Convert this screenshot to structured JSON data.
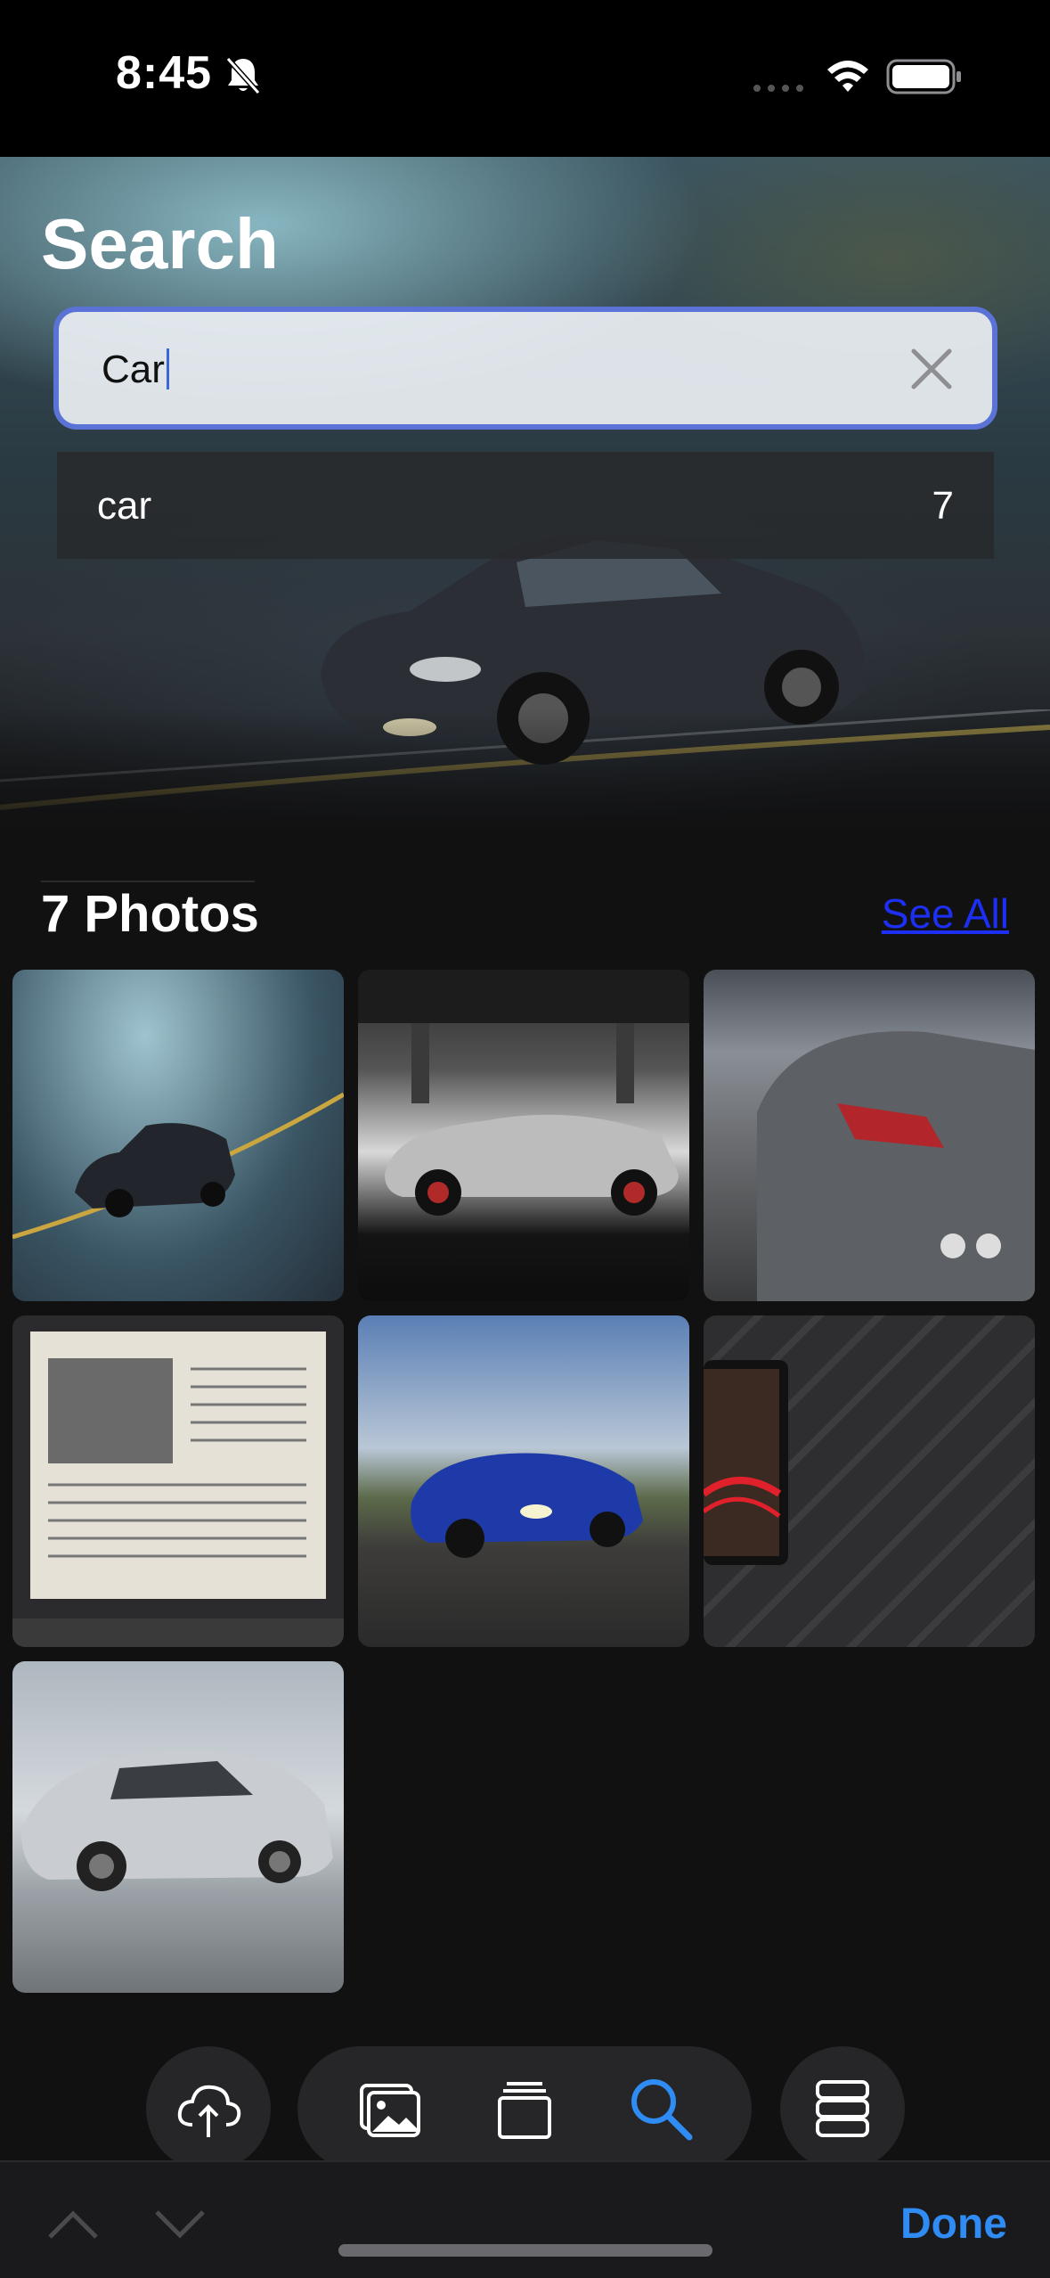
{
  "status_bar": {
    "time": "8:45",
    "icons": [
      "bell-slash-icon",
      "cellular-dots-icon",
      "wifi-icon",
      "battery-icon"
    ]
  },
  "search": {
    "title": "Search",
    "query": "Car",
    "clear_icon": "xmark-icon"
  },
  "suggestion": {
    "label": "car",
    "count": "7"
  },
  "results": {
    "heading": "7 Photos",
    "see_all": "See All",
    "photos": [
      {
        "subject": "hatchback on mountain road"
      },
      {
        "subject": "silver sports car under bridge"
      },
      {
        "subject": "grey coupe rear view"
      },
      {
        "subject": "newspaper clipping on board"
      },
      {
        "subject": "blue coupe on highway"
      },
      {
        "subject": "phone with light trails"
      },
      {
        "subject": "silver porsche"
      }
    ]
  },
  "toolbar": {
    "items": [
      "cloud-upload-icon",
      "photos-icon",
      "albums-icon",
      "search-icon",
      "menu-stack-icon"
    ],
    "active": "search-icon",
    "accent": "#2f8cf4"
  },
  "bottom_bar": {
    "done_label": "Done"
  },
  "colors": {
    "accent": "#2f8cf4",
    "link": "#1c2ff2",
    "search_border": "#5b73d6"
  }
}
